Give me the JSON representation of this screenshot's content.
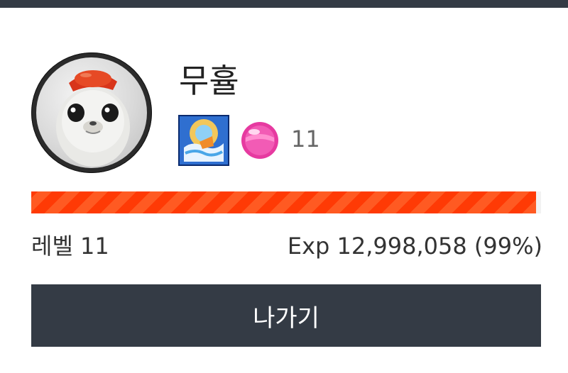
{
  "profile": {
    "name": "무휼",
    "level_badge_value": "11",
    "avatar_icon": "seal-avatar-icon",
    "badge_icon": "ship-emblem-icon",
    "gem_icon": "pink-gem-icon"
  },
  "progress": {
    "fraction": 0.99,
    "level_label": "레벨 11",
    "exp_label": "Exp 12,998,058 (99%)",
    "color": "#ff4a12"
  },
  "actions": {
    "exit_label": "나가기"
  },
  "colors": {
    "topbar": "#343b45",
    "button_bg": "#343b45"
  }
}
